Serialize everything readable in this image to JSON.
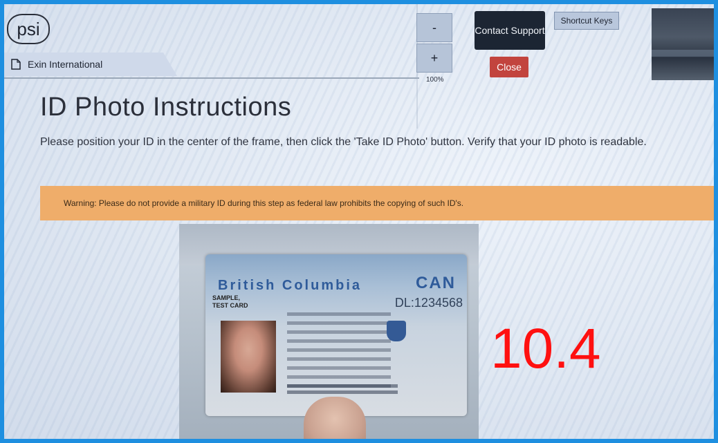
{
  "header": {
    "logo_text": "psi",
    "tab_label": "Exin International"
  },
  "toolbar": {
    "zoom_out_label": "-",
    "zoom_in_label": "+",
    "zoom_level": "100%",
    "contact_support_label": "Contact Support",
    "close_label": "Close",
    "shortcut_keys_label": "Shortcut Keys"
  },
  "main": {
    "title": "ID Photo Instructions",
    "instructions": "Please position your ID in the center of the frame, then click the 'Take ID Photo' button. Verify that your ID photo is readable.",
    "warning": "Warning: Please do not provide a military ID during this step as federal law prohibits the copying of such ID's."
  },
  "id_card": {
    "province": "British Columbia",
    "country": "CAN",
    "name_line1": "SAMPLE,",
    "name_line2": "TEST CARD",
    "dl_number": "DL:1234568"
  },
  "overlay": {
    "countdown": "10.4"
  },
  "colors": {
    "frame_border": "#1e8fe0",
    "warning_bg": "#efad6a",
    "close_bg": "#c2443e",
    "contact_bg": "#1c2533",
    "countdown": "#ff1010"
  }
}
